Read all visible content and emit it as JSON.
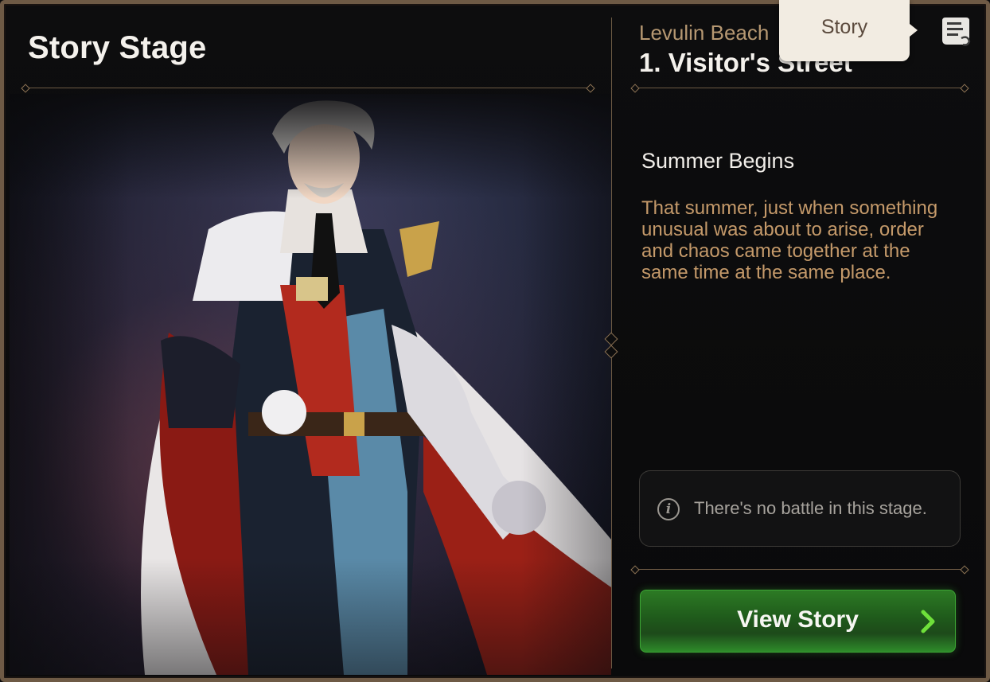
{
  "header": {
    "title": "Story Stage"
  },
  "stage": {
    "location": "Levulin Beach",
    "name": "1. Visitor's Street"
  },
  "story": {
    "title": "Summer Begins",
    "description": "That summer, just when something unusual was about to arise, order and chaos came together at the same time at the same place."
  },
  "info": {
    "icon": "info-icon",
    "text": "There's no battle in this stage."
  },
  "actions": {
    "view_story_label": "View Story"
  },
  "tooltip": {
    "label": "Story"
  },
  "icons": {
    "story_scroll": "scroll-icon"
  },
  "colors": {
    "accent_gold": "#b69872",
    "description_text": "#c59a6a",
    "button_green": "#2c7a24",
    "arrow_green": "#6fe03a"
  }
}
